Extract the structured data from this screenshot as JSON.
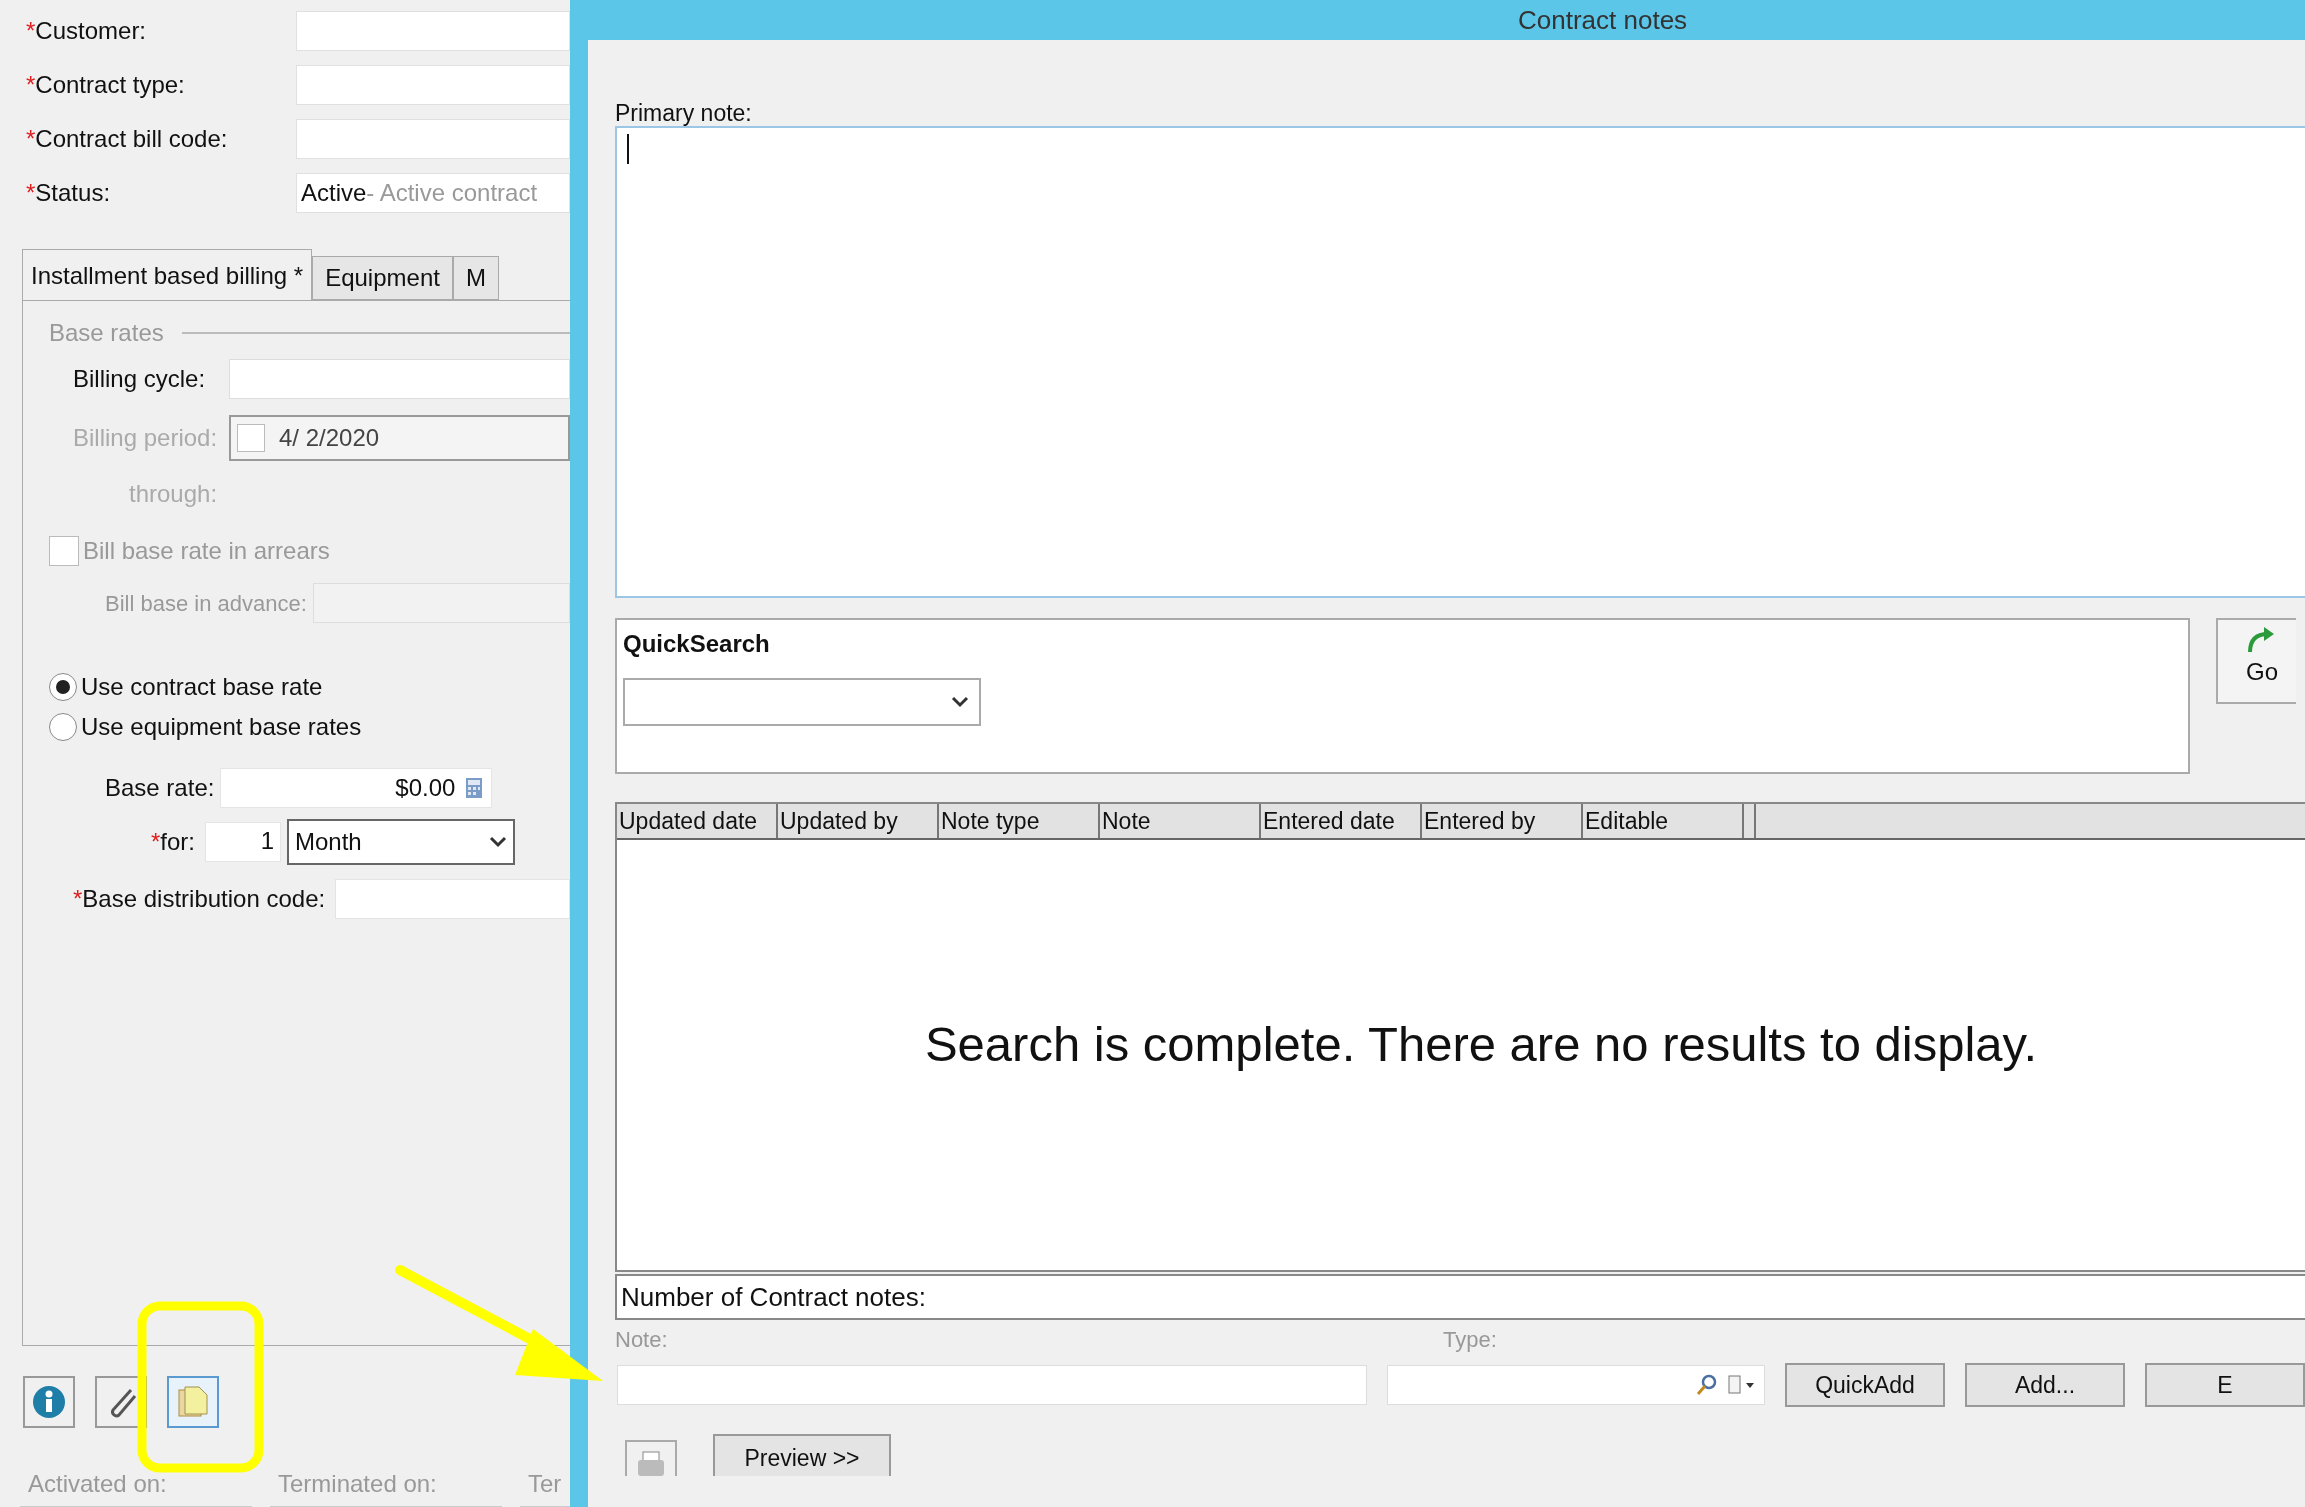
{
  "form": {
    "fields": [
      {
        "label": "Customer:",
        "required_mark": "*"
      },
      {
        "label": "Contract type:",
        "required_mark": "*"
      },
      {
        "label": "Contract bill code:",
        "required_mark": "*"
      },
      {
        "label": "Status:",
        "required_mark": "*",
        "value": "Active",
        "description": " - Active contract"
      }
    ]
  },
  "tabs": [
    {
      "label": "Installment based billing *",
      "selected": true
    },
    {
      "label": "Equipment",
      "selected": false
    },
    {
      "label": "M",
      "selected": false
    }
  ],
  "base_rates": {
    "title": "Base rates",
    "billing_cycle": {
      "label": "Billing cycle:"
    },
    "billing_period": {
      "label": "Billing period:",
      "checked": false,
      "value": "4/  2/2020"
    },
    "through": {
      "label": "through:"
    },
    "arrears": {
      "label": "Bill base rate in arrears",
      "checked": false
    },
    "advance": {
      "label": "Bill base in advance:"
    },
    "rate_options": [
      {
        "label": "Use contract base rate",
        "selected": true
      },
      {
        "label": "Use equipment base rates",
        "selected": false
      }
    ],
    "base_rate": {
      "label": "Base rate:",
      "value": "$0.00"
    },
    "period": {
      "label": "for:",
      "required_mark": "*",
      "count": "1",
      "unit": "Month"
    },
    "distribution": {
      "label": "Base distribution code:",
      "required_mark": "*"
    }
  },
  "toolbar": [
    {
      "kind": "info",
      "selected": false
    },
    {
      "kind": "attach",
      "selected": false
    },
    {
      "kind": "notes",
      "selected": true
    }
  ],
  "footer_labels": [
    "Activated on:",
    "Terminated on:",
    "Ter"
  ],
  "dialog": {
    "title": "Contract notes",
    "primary_note_label": "Primary note:",
    "quicksearch": {
      "title": "QuickSearch"
    },
    "go_button": "Go",
    "table": {
      "columns": [
        "Updated date",
        "Updated by",
        "Note type",
        "Note",
        "Entered date",
        "Entered by",
        "Editable"
      ],
      "empty_message": "Search is complete. There are no results to display."
    },
    "count_label": "Number of Contract notes:",
    "note_label": "Note:",
    "type_label": "Type:",
    "buttons": [
      "QuickAdd",
      "Add...",
      "E"
    ],
    "preview_button": "Preview >>"
  }
}
